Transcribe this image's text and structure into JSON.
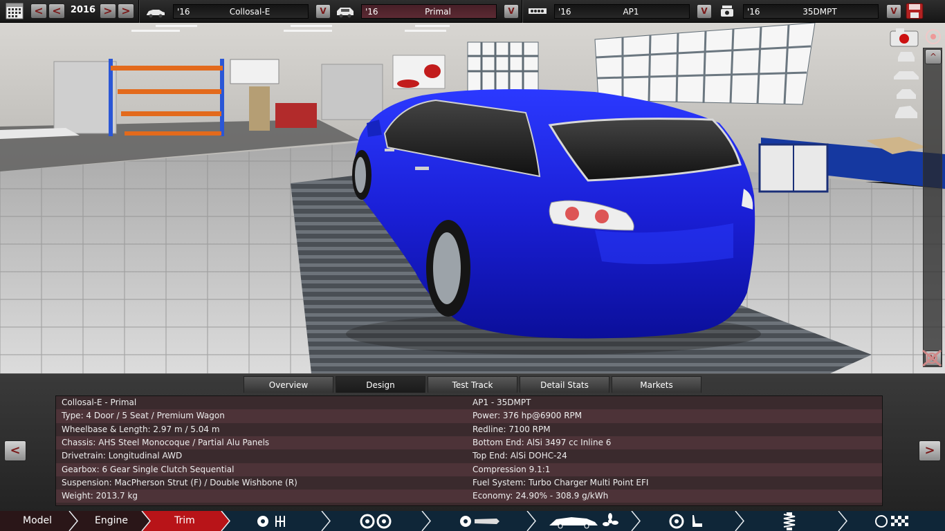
{
  "toolbar": {
    "year": "2016",
    "prev_label": "<",
    "next_label": ">",
    "selectors": [
      {
        "year": "'16",
        "name": "Collosal-E",
        "dropdown": "V"
      },
      {
        "year": "'16",
        "name": "Primal",
        "dropdown": "V"
      },
      {
        "year": "'16",
        "name": "AP1",
        "dropdown": "V"
      },
      {
        "year": "'16",
        "name": "35DMPT",
        "dropdown": "V"
      }
    ],
    "icons": [
      "calendar-icon",
      "car-model-icon",
      "car-trim-icon",
      "engine-block-icon",
      "engine-variant-icon",
      "save-icon"
    ]
  },
  "scene": {
    "car_color": "#1a1fd6",
    "scroll_up": "^",
    "scroll_down": "V"
  },
  "tabs": [
    "Overview",
    "Design",
    "Test Track",
    "Detail Stats",
    "Markets"
  ],
  "active_tab": "Design",
  "info": {
    "left": [
      "Collosal-E - Primal",
      "Type: 4 Door / 5 Seat / Premium Wagon",
      "Wheelbase & Length: 2.97 m / 5.04 m",
      "Chassis: AHS Steel Monocoque / Partial Alu Panels",
      "Drivetrain: Longitudinal AWD",
      "Gearbox: 6 Gear Single Clutch Sequential",
      "Suspension: MacPherson Strut (F) / Double Wishbone (R)",
      "Weight: 2013.7 kg"
    ],
    "right": [
      "AP1 - 35DMPT",
      "Power: 376 hp@6900 RPM",
      "Redline: 7100 RPM",
      "Bottom End: AlSi 3497 cc Inline 6",
      "Top End: AlSi DOHC-24",
      "Compression 9.1:1",
      "Fuel System: Turbo Charger Multi Point EFI",
      "Economy: 24.90% - 308.9 g/kWh"
    ],
    "prev_label": "<",
    "next_label": ">"
  },
  "bottom_nav": {
    "items": [
      "Model",
      "Engine",
      "Trim"
    ],
    "active": "Trim",
    "icon_groups": [
      "gearbox-icons",
      "wheels-icons",
      "brakes-icons",
      "body-fan-icons",
      "interior-icons",
      "suspension-icons",
      "test-drive-icons"
    ]
  }
}
